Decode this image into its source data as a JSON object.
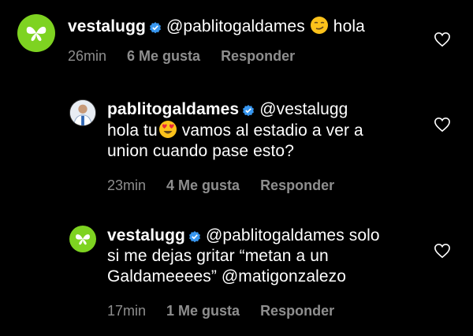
{
  "comments": [
    {
      "username": "vestalugg",
      "mention": "@pablitogaldames",
      "emoji": "smirking-face",
      "text_after_emoji": "hola",
      "time": "26min",
      "likes": "6 Me gusta",
      "reply": "Responder"
    },
    {
      "username": "pablitogaldames",
      "mention": "@vestalugg",
      "text_before_emoji": "hola tu",
      "emoji": "heart-eyes-face",
      "text_after_emoji": "vamos al estadio a ver a",
      "text_line3": "union cuando pase esto?",
      "time": "23min",
      "likes": "4 Me gusta",
      "reply": "Responder"
    },
    {
      "username": "vestalugg",
      "mention": "@pablitogaldames",
      "text_rest": "solo",
      "text_line2": "si me dejas gritar “metan a un",
      "text_line3": "Galdameeees”",
      "mention2": "@matigonzalezo",
      "time": "17min",
      "likes": "1 Me gusta",
      "reply": "Responder"
    }
  ],
  "colors": {
    "background": "#000000",
    "text": "#ffffff",
    "meta": "#8e8e8e",
    "verified": "#3897f0",
    "avatar_green": "#7ed321"
  },
  "icons": [
    "verified-badge-icon",
    "like-heart-icon",
    "butterfly-avatar-icon"
  ]
}
